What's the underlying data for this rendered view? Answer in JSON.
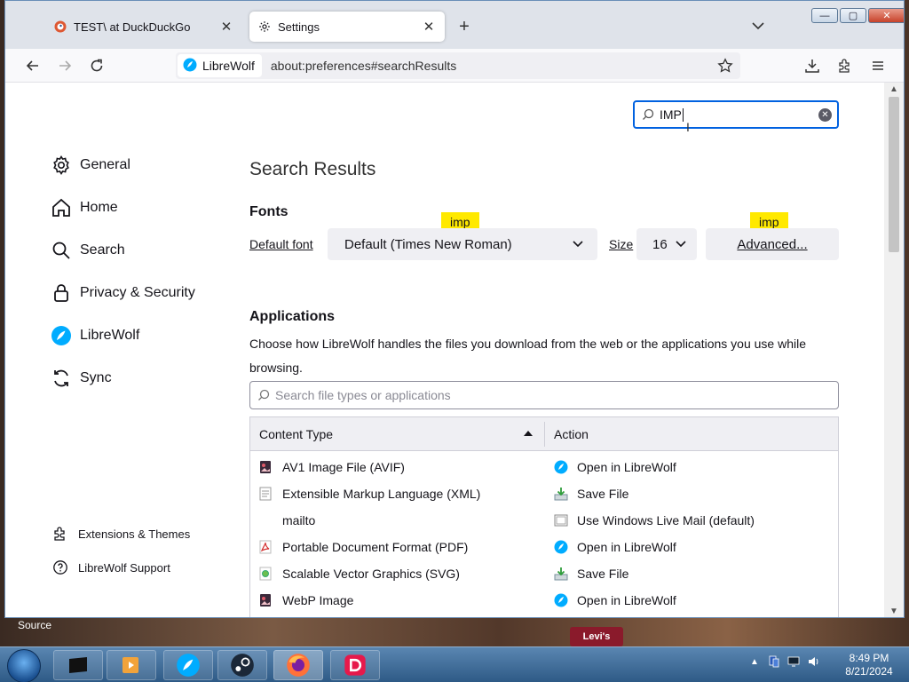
{
  "browser": {
    "tabs": [
      {
        "label": "TEST\\ at DuckDuckGo",
        "close": "✕"
      },
      {
        "label": "Settings",
        "close": "✕"
      }
    ],
    "new_tab": "+",
    "identity_label": "LibreWolf",
    "url": "about:preferences#searchResults",
    "window_buttons": {
      "minimize": "—",
      "maximize": "▢",
      "close": "✕"
    }
  },
  "search": {
    "value": "IMP",
    "clear": "✕"
  },
  "sidebar": {
    "items": [
      {
        "label": "General",
        "icon": "gear-icon"
      },
      {
        "label": "Home",
        "icon": "home-icon"
      },
      {
        "label": "Search",
        "icon": "search-icon"
      },
      {
        "label": "Privacy & Security",
        "icon": "lock-icon"
      },
      {
        "label": "LibreWolf",
        "icon": "librewolf-icon"
      },
      {
        "label": "Sync",
        "icon": "sync-icon"
      }
    ],
    "footer": [
      {
        "label": "Extensions & Themes",
        "icon": "puzzle-icon"
      },
      {
        "label": "LibreWolf Support",
        "icon": "help-icon"
      }
    ]
  },
  "main": {
    "heading": "Search Results",
    "fonts": {
      "heading": "Fonts",
      "default_font_label": "Default font",
      "default_font_value": "Default (Times New Roman)",
      "size_label": "Size",
      "size_value": "16",
      "advanced_label": "Advanced...",
      "highlight": "imp"
    },
    "applications": {
      "heading": "Applications",
      "description": "Choose how LibreWolf handles the files you download from the web or the applications you use while browsing.",
      "filter_placeholder": "Search file types or applications",
      "columns": [
        "Content Type",
        "Action"
      ],
      "rows": [
        {
          "type": "AV1 Image File (AVIF)",
          "type_icon": "image-file-icon",
          "action": "Open in LibreWolf",
          "action_icon": "librewolf-icon"
        },
        {
          "type": "Extensible Markup Language (XML)",
          "type_icon": "document-icon",
          "action": "Save File",
          "action_icon": "save-file-icon"
        },
        {
          "type": "mailto",
          "type_icon": "",
          "action": "Use Windows Live Mail (default)",
          "action_icon": "mail-app-icon"
        },
        {
          "type": "Portable Document Format (PDF)",
          "type_icon": "pdf-icon",
          "action": "Open in LibreWolf",
          "action_icon": "librewolf-icon"
        },
        {
          "type": "Scalable Vector Graphics (SVG)",
          "type_icon": "svg-file-icon",
          "action": "Save File",
          "action_icon": "save-file-icon"
        },
        {
          "type": "WebP Image",
          "type_icon": "image-file-icon",
          "action": "Open in LibreWolf",
          "action_icon": "librewolf-icon"
        }
      ]
    }
  },
  "desktop": {
    "caption": "Source",
    "badge": "Levi's"
  },
  "taskbar": {
    "time": "8:49 PM",
    "date": "8/21/2024"
  },
  "colors": {
    "accent": "#0061e0",
    "highlight": "#ffe900",
    "librewolf": "#00acff"
  }
}
